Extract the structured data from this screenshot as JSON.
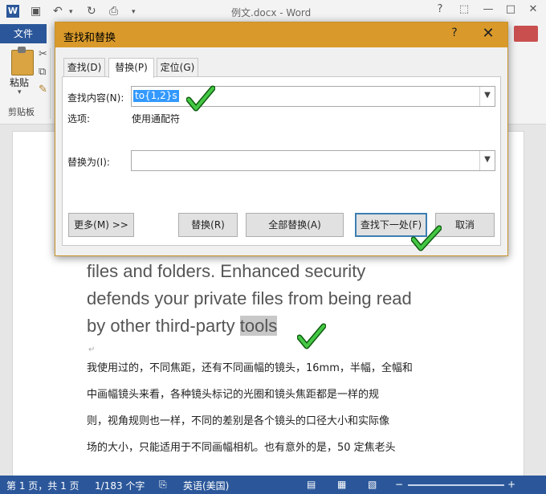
{
  "word": {
    "title": "例文.docx - Word",
    "app_icon": "W",
    "window_controls": [
      "?",
      "⬚",
      "—",
      "□",
      "✕"
    ]
  },
  "ribbon": {
    "file_tab": "文件",
    "paste_label": "粘贴",
    "clipboard_label": "剪贴板"
  },
  "dialog": {
    "title": "查找和替换",
    "help": "?",
    "close": "✕",
    "tabs": [
      {
        "label": "查找(D)",
        "active": false
      },
      {
        "label": "替换(P)",
        "active": true
      },
      {
        "label": "定位(G)",
        "active": false
      }
    ],
    "find_label": "查找内容(N):",
    "find_value": "to{1,2}s",
    "options_label": "选项:",
    "options_value": "使用通配符",
    "replace_label": "替换为(I):",
    "replace_value": "",
    "buttons": {
      "more": "更多(M) >>",
      "replace": "替换(R)",
      "replace_all": "全部替换(A)",
      "find_next": "查找下一处(F)",
      "cancel": "取消"
    }
  },
  "document": {
    "en_lines": [
      "files and folders. Enhanced security",
      "defends your private files from being read"
    ],
    "en_last_prefix": "by other third-party ",
    "en_highlight": "tools",
    "zh_lines": [
      "我使用过的，不同焦距，还有不同画幅的镜头，16mm，半幅，全幅和",
      "中画幅镜头来看，各种镜头标记的光圈和镜头焦距都是一样的规",
      "则，视角规则也一样，不同的差别是各个镜头的口径大小和实际像",
      "场的大小，只能适用于不同画幅相机。也有意外的是，50 定焦老头"
    ]
  },
  "status": {
    "page": "第 1 页，共 1 页",
    "words": "1/183 个字",
    "language": "英语(美国)"
  },
  "colors": {
    "word_blue": "#2b579a",
    "dialog_title": "#d99a2b",
    "check_green": "#2ea02e"
  }
}
